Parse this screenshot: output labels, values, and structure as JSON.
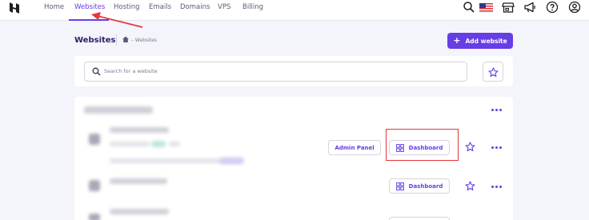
{
  "nav": {
    "items": [
      "Home",
      "Websites",
      "Hosting",
      "Emails",
      "Domains",
      "VPS",
      "Billing"
    ],
    "active": "Websites"
  },
  "header": {
    "title": "Websites",
    "breadcrumb": "– Websites",
    "add_label": "Add website"
  },
  "search": {
    "placeholder": "Search for a website"
  },
  "rows": [
    {
      "admin_label": "Admin Panel",
      "dashboard_label": "Dashboard"
    },
    {
      "dashboard_label": "Dashboard"
    }
  ],
  "colors": {
    "accent": "#673de6",
    "annotation": "#e5363d"
  }
}
